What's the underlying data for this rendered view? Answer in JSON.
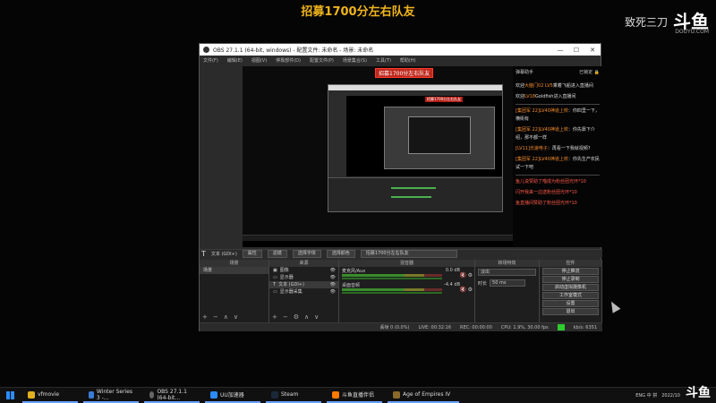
{
  "stream": {
    "title": "招募1700分左右队友"
  },
  "brand": {
    "streamer": "致死三刀",
    "logo": "斗鱼",
    "logo_sub": "DOUYU.COM"
  },
  "obs": {
    "window_title": "OBS 27.1.1 (64-bit, windows) - 配置文件: 未命名 - 场景: 未命名",
    "window_controls": [
      "—",
      "☐",
      "✕"
    ],
    "menu": [
      "文件(F)",
      "编辑(E)",
      "视图(V)",
      "停靠部件(D)",
      "配置文件(P)",
      "场景集合(S)",
      "工具(T)",
      "帮助(H)"
    ],
    "preview_label": "招募1700分左右队友",
    "source_bar": {
      "source_name": "文本 (GDI+)",
      "properties": "属性",
      "filters": "滤镜",
      "select_font": "选择字体",
      "select_color": "选择颜色",
      "text_value": "招募1700分左右队友"
    },
    "dock_headers": [
      "场景",
      "来源",
      "混音器",
      "转场特效",
      "控件"
    ],
    "scenes": [
      "场景"
    ],
    "sources": [
      {
        "label": "图像",
        "icon": "image-icon"
      },
      {
        "label": "显示器",
        "icon": "monitor-icon"
      },
      {
        "label": "文本 (GDI+)",
        "icon": "text-icon"
      },
      {
        "label": "显示器采集",
        "icon": "monitor-icon"
      }
    ],
    "mixer": [
      {
        "name": "麦克风/Aux",
        "value": "0.0 dB"
      },
      {
        "name": "桌面音频",
        "value": "-4.4 dB"
      }
    ],
    "transitions": {
      "type": "淡出",
      "duration_label": "时长",
      "duration_value": "50 ms"
    },
    "controls": [
      "停止推流",
      "停止录制",
      "启动虚拟摄像机",
      "工作室模式",
      "设置",
      "退出"
    ],
    "status": {
      "dropped": "丢帧 0 (0.0%)",
      "live": "LIVE: 00:32:16",
      "rec": "REC: 00:00:00",
      "cpu": "CPU: 1.9%, 30.00 fps",
      "kbps": "kb/s: 6351"
    }
  },
  "chat": {
    "header": "弹幕助手",
    "header_right": "已锁定",
    "messages": [
      {
        "pre": "欢迎",
        "hl": "大脑门02 LV5",
        "post": "乘着飞船进入直播间"
      },
      {
        "pre": "欢迎",
        "hl": "LV18",
        "post": "Goldfish进入直播间"
      },
      {
        "pre": "",
        "hl": "[集团军 22]LV40神道上校",
        "post": "：你四里一下，横街有"
      },
      {
        "pre": "",
        "hl": "[集团军 22]LV40神道上校",
        "post": "：你先靠下介绍，那不都一样"
      },
      {
        "pre": "",
        "hl": "[LV11]光速电子",
        "post": "：再看一下我就视频?"
      },
      {
        "pre": "",
        "hl": "[集团军 22]LV40神道上校",
        "post": "：你先生产农民试一下吧"
      }
    ],
    "red_messages": [
      "鱼儿说赞助了喵成为粉丝团光环*10",
      "闪开我来一边送粉丝团光环*10",
      "鱼直播间赞助了粉丝团光环*10"
    ]
  },
  "taskbar": {
    "items": [
      "vfmovie",
      "Winter Series 3 -...",
      "OBS 27.1.1 (64-bit...",
      "UU加速器",
      "Steam",
      "斗鱼直播伴侣",
      "Age of Empires IV"
    ],
    "tray": "ENG 中 拼",
    "clock_date": "2022/10",
    "brand": "斗鱼"
  }
}
